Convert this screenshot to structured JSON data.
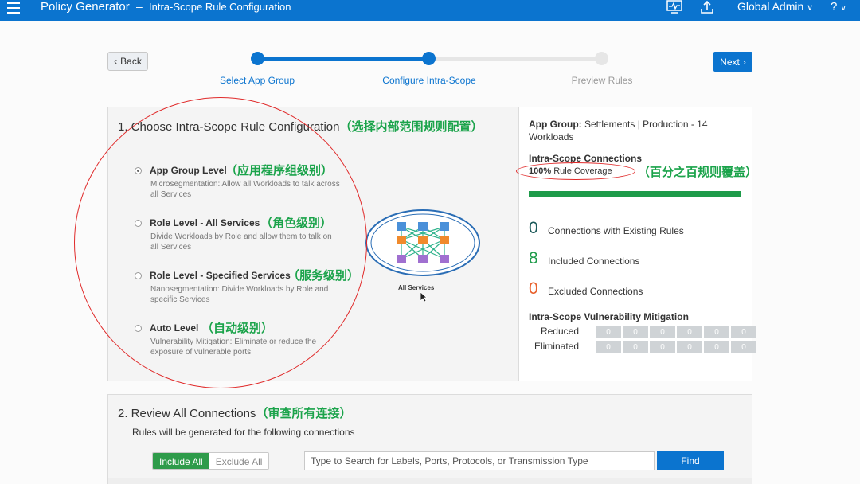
{
  "header": {
    "app_title": "Policy Generator",
    "separator": "–",
    "subtitle": "Intra-Scope Rule Configuration",
    "user_menu": "Global Admin",
    "help": "?"
  },
  "nav": {
    "back_label": "Back",
    "next_label": "Next"
  },
  "stepper": {
    "steps": [
      {
        "label": "Select App Group",
        "state": "done"
      },
      {
        "label": "Configure Intra-Scope",
        "state": "current"
      },
      {
        "label": "Preview Rules",
        "state": "todo"
      }
    ]
  },
  "config": {
    "title": "1. Choose Intra-Scope Rule Configuration",
    "title_cn": "（选择内部范围规则配置）",
    "options": [
      {
        "label": "App Group Level",
        "cn": "（应用程序组级别）",
        "desc": "Microsegmentation: Allow all Workloads to talk across all Services",
        "selected": true
      },
      {
        "label": "Role Level - All Services",
        "cn": "（角色级别）",
        "desc": "Divide Workloads by Role and allow them to talk on all Services",
        "selected": false
      },
      {
        "label": "Role Level - Specified Services",
        "cn": "（服务级别）",
        "desc": "Nanosegmentation: Divide Workloads by Role and specific Services",
        "selected": false
      },
      {
        "label": "Auto Level",
        "cn": "（自动级别）",
        "desc": "Vulnerability Mitigation: Eliminate or reduce the exposure of vulnerable ports",
        "selected": false
      }
    ],
    "diagram_label": "All Services"
  },
  "summary": {
    "app_group_label": "App Group:",
    "app_group_value": "Settlements | Production - 14 Workloads",
    "connections_head": "Intra-Scope Connections",
    "coverage_pct": "100%",
    "coverage_text": "Rule Coverage",
    "coverage_cn": "（百分之百规则覆盖）",
    "coverage_fraction": 1.0,
    "stats": [
      {
        "num": "0",
        "text": "Connections with Existing Rules",
        "color": "#1c5a5a"
      },
      {
        "num": "8",
        "text": "Included Connections",
        "color": "#1e9b4a"
      },
      {
        "num": "0",
        "text": "Excluded Connections",
        "color": "#e8602c"
      }
    ],
    "vuln_head": "Intra-Scope Vulnerability Mitigation",
    "vuln_rows": [
      {
        "label": "Reduced",
        "values": [
          "0",
          "0",
          "0",
          "0",
          "0",
          "0"
        ]
      },
      {
        "label": "Eliminated",
        "values": [
          "0",
          "0",
          "0",
          "0",
          "0",
          "0"
        ]
      }
    ]
  },
  "review": {
    "title": "2. Review All Connections",
    "title_cn": "（审查所有连接）",
    "subtitle": "Rules will be generated for the following connections",
    "include_all": "Include All",
    "exclude_all": "Exclude All",
    "search_placeholder": "Type to Search for Labels, Ports, Protocols, or Transmission Type",
    "find_label": "Find"
  },
  "colors": {
    "brand": "#0b74cf",
    "annotation_green": "#1aa34a",
    "annotation_red": "#e02a2a",
    "coverage_bar": "#1e9b4a"
  }
}
